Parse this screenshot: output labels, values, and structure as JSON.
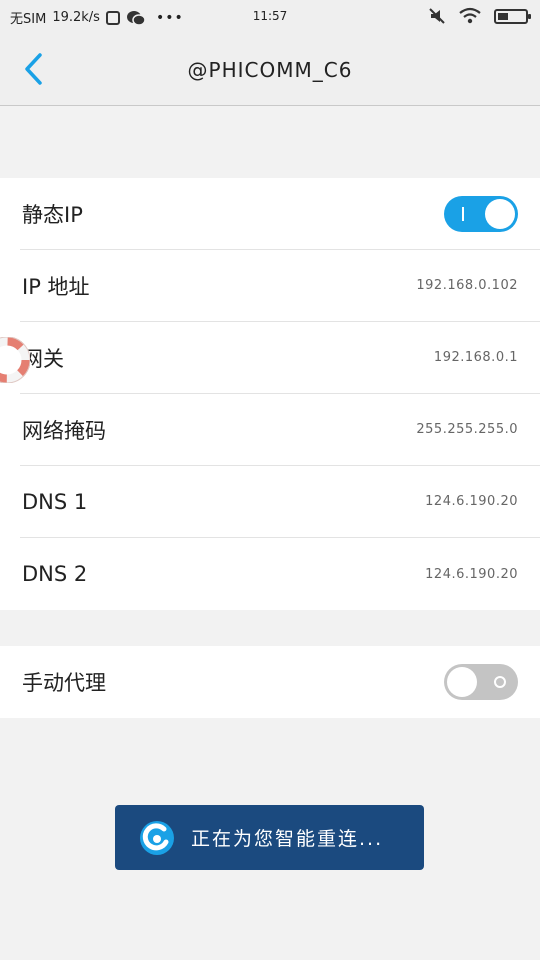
{
  "status_bar": {
    "carrier": "无SIM",
    "speed": "19.2k/s",
    "time": "11:57",
    "more": "•••"
  },
  "header": {
    "title": "@PHICOMM_C6"
  },
  "static_ip": {
    "label": "静态IP",
    "enabled": true
  },
  "fields": [
    {
      "label": "IP 地址",
      "value": "192.168.0.102"
    },
    {
      "label": "网关",
      "value": "192.168.0.1"
    },
    {
      "label": "网络掩码",
      "value": "255.255.255.0"
    },
    {
      "label": "DNS 1",
      "value": "124.6.190.20"
    },
    {
      "label": "DNS 2",
      "value": "124.6.190.20"
    }
  ],
  "proxy": {
    "label": "手动代理",
    "enabled": false
  },
  "toast": {
    "text": "正在为您智能重连..."
  },
  "colors": {
    "accent": "#1aa1e6",
    "toast_bg": "#1b4a7f",
    "toggle_off": "#c4c4c4"
  }
}
